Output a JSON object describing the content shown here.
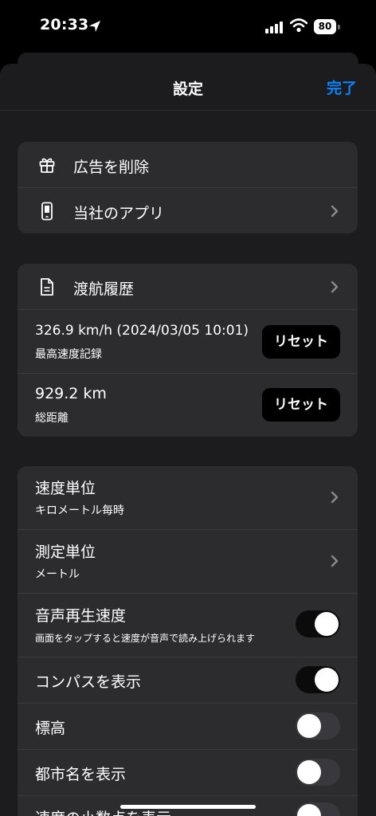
{
  "status_bar": {
    "time": "20:33",
    "battery": "80"
  },
  "nav": {
    "title": "設定",
    "done": "完了"
  },
  "group1": [
    {
      "label": "広告を削除",
      "icon": "gift-icon"
    },
    {
      "label": "当社のアプリ",
      "icon": "phone-icon",
      "chevron": true
    }
  ],
  "group2": {
    "history_label": "渡航履歴",
    "max_speed_value": "326.9 km/h (2024/03/05 10:01)",
    "max_speed_label": "最高速度記録",
    "distance_value": "929.2 km",
    "distance_label": "総距離",
    "reset_label": "リセット"
  },
  "group3": {
    "speed_unit_label": "速度単位",
    "speed_unit_value": "キロメートル毎時",
    "measure_unit_label": "測定単位",
    "measure_unit_value": "メートル",
    "voice_label": "音声再生速度",
    "voice_desc": "画面をタップすると速度が音声で読み上げられます",
    "voice_on": true,
    "compass_label": "コンパスを表示",
    "compass_on": true,
    "altitude_label": "標高",
    "altitude_on": false,
    "city_label": "都市名を表示",
    "city_on": false,
    "decimal_label": "速度の小数点を表示",
    "decimal_on": false
  },
  "colors": {
    "accent": "#0a84ff",
    "group_bg": "#2c2c2e",
    "sheet_bg": "#1c1c1e"
  }
}
